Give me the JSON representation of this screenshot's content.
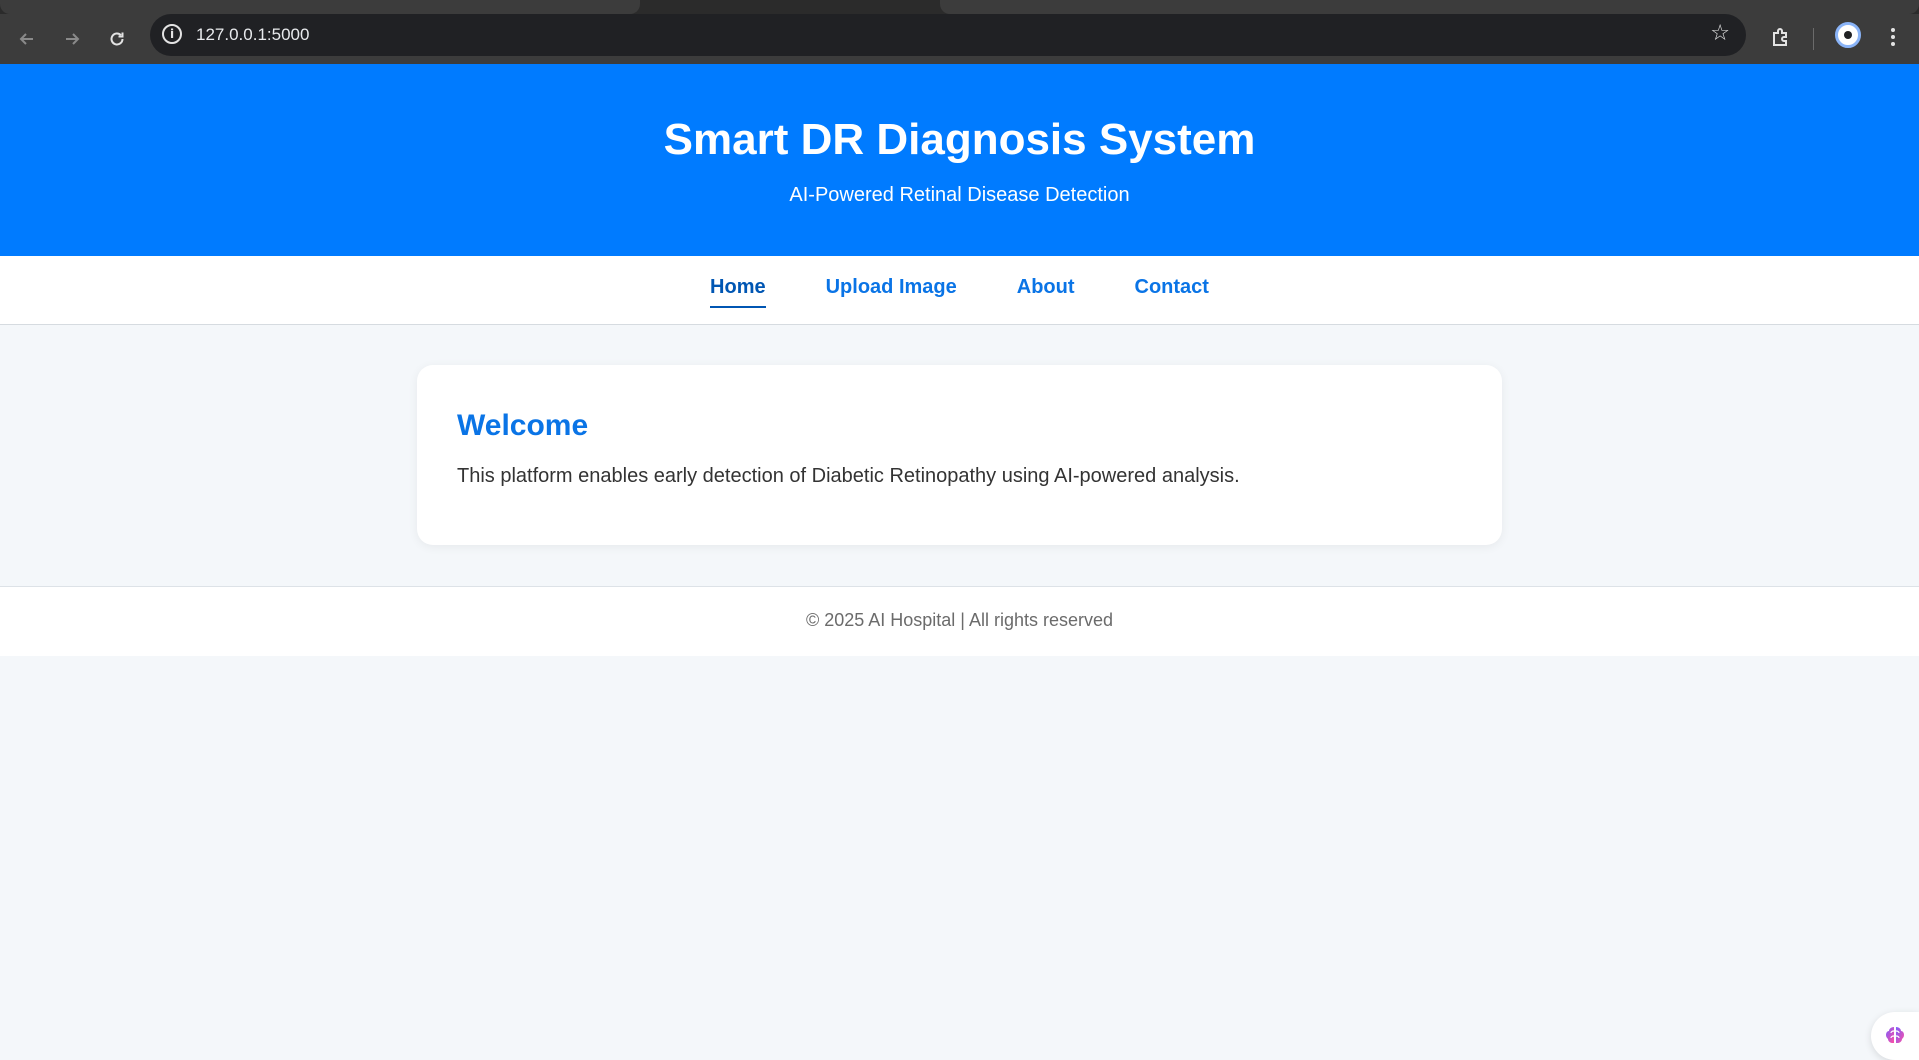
{
  "browser": {
    "url": "127.0.0.1:5000",
    "back_icon": "arrow-left-icon",
    "forward_icon": "arrow-right-icon",
    "reload_icon": "reload-icon",
    "site_info_icon": "info-icon",
    "bookmark_icon": "star-icon",
    "extensions_icon": "puzzle-icon",
    "menu_icon": "kebab-menu-icon"
  },
  "header": {
    "title": "Smart DR Diagnosis System",
    "subtitle": "AI-Powered Retinal Disease Detection",
    "background_color": "#007bff"
  },
  "nav": {
    "items": [
      {
        "label": "Home",
        "active": true
      },
      {
        "label": "Upload Image",
        "active": false
      },
      {
        "label": "About",
        "active": false
      },
      {
        "label": "Contact",
        "active": false
      }
    ]
  },
  "welcome": {
    "heading": "Welcome",
    "text": "This platform enables early detection of Diabetic Retinopathy using AI-powered analysis."
  },
  "footer": {
    "text": "© 2025 AI Hospital | All rights reserved"
  },
  "widget": {
    "icon": "brain-icon"
  }
}
